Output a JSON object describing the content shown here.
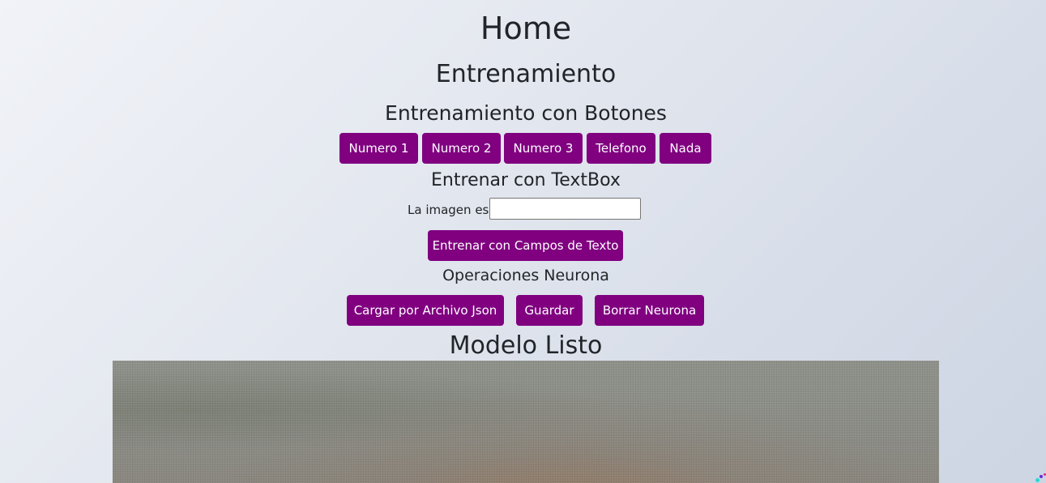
{
  "page": {
    "title": "Home",
    "section_title": "Entrenamiento",
    "buttons_heading": "Entrenamiento con Botones",
    "textbox_heading": "Entrenar con TextBox",
    "operations_heading": "Operaciones Neurona",
    "status": "Modelo Listo"
  },
  "training_buttons": [
    {
      "label": "Numero 1"
    },
    {
      "label": "Numero 2"
    },
    {
      "label": "Numero 3"
    },
    {
      "label": "Telefono"
    },
    {
      "label": "Nada"
    }
  ],
  "textbox": {
    "label": "La imagen es:",
    "value": "",
    "submit_label": "Entrenar con Campos de Texto"
  },
  "operations": {
    "load_label": "Cargar por Archivo Json",
    "save_label": "Guardar",
    "delete_label": "Borrar Neurona"
  },
  "colors": {
    "button_bg": "#800080",
    "button_text": "#ffffff",
    "text": "#212529"
  }
}
